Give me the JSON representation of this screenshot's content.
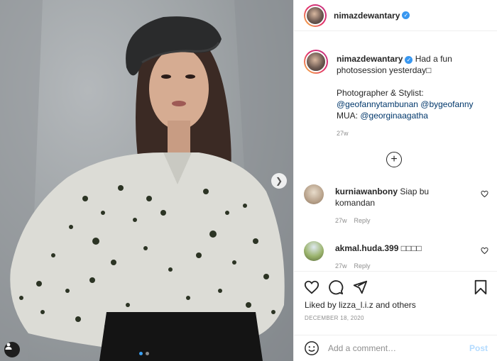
{
  "post": {
    "username": "nimazdewantary",
    "verified": true,
    "caption_lines": [
      "Had a fun",
      "photosession yesterday□"
    ],
    "caption_credit_heading": "Photographer & Stylist:",
    "caption_mentions_line1": [
      "@geofannytambunan",
      "@bygeofanny"
    ],
    "caption_mua_label": "MUA:",
    "caption_mua_mention": "@georginaagatha",
    "caption_time": "27w"
  },
  "comments": [
    {
      "username": "kurniawanbony",
      "text": "Siap bu komandan",
      "time": "27w",
      "reply_label": "Reply"
    },
    {
      "username": "akmal.huda.399",
      "text": "□□□□",
      "time": "27w",
      "reply_label": "Reply"
    }
  ],
  "likes": {
    "prefix": "Liked by",
    "user": "lizza_l.i.z",
    "suffix": "and others"
  },
  "date": "DECEMBER 18, 2020",
  "add_comment": {
    "placeholder": "Add a comment…",
    "post_label": "Post"
  },
  "carousel": {
    "count": 2,
    "active_index": 0
  },
  "icons": {
    "verified": "verified-badge-icon",
    "next": "chevron-right-icon",
    "tag": "user-tag-icon",
    "load_more": "plus-circle-icon",
    "like": "heart-icon",
    "comment": "comment-icon",
    "share": "share-icon",
    "save": "bookmark-icon",
    "emoji": "emoji-icon"
  },
  "colors": {
    "link": "#00376b",
    "verified": "#3897f0",
    "post_button": "#b3dbff",
    "carousel_active": "#3aa0f3"
  }
}
